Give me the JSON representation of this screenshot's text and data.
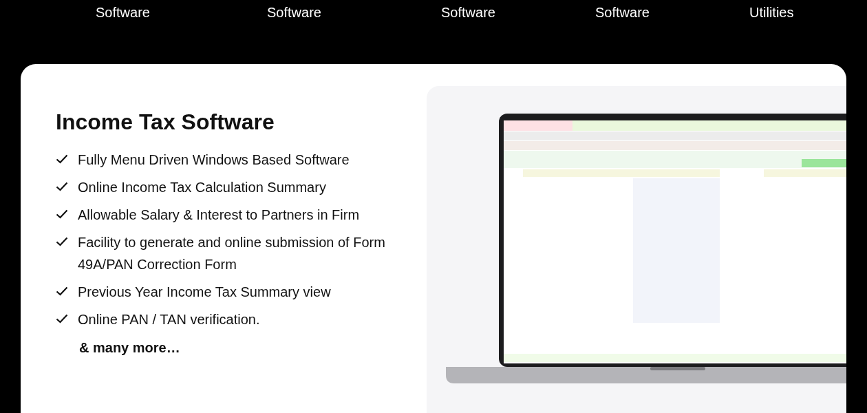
{
  "nav": [
    {
      "label": "Software"
    },
    {
      "label": "Software"
    },
    {
      "label": "Software"
    },
    {
      "label": "Software"
    },
    {
      "label": "Utilities"
    }
  ],
  "heading": "Income Tax Software",
  "features": [
    "Fully Menu Driven Windows Based Software",
    "Online Income Tax Calculation Summary",
    "Allowable Salary & Interest to Partners in Firm",
    "Facility to generate and online submission of Form 49A/PAN Correction Form",
    "Previous Year Income Tax Summary view",
    "Online PAN / TAN verification."
  ],
  "more": "& many more…"
}
